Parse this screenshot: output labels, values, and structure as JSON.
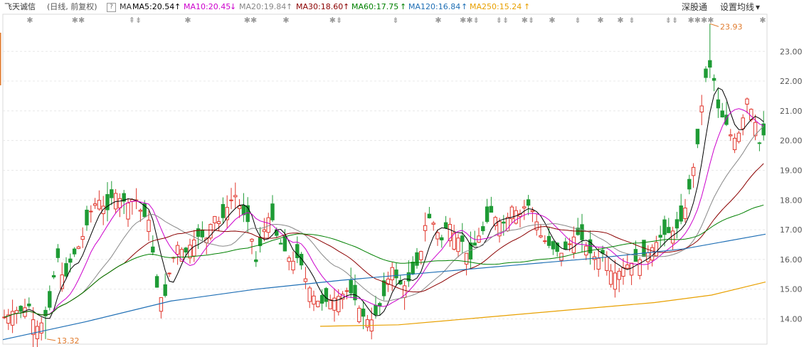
{
  "header": {
    "stock_name": "飞天诚信",
    "mode": "(日线, 前复权)",
    "help_icon": "?",
    "ma_label": "MA",
    "mas": [
      {
        "label": "MA5:20.54",
        "arrow": "↑",
        "color": "#000000"
      },
      {
        "label": "MA10:20.45",
        "arrow": "↓",
        "color": "#cc00cc"
      },
      {
        "label": "MA20:19.84",
        "arrow": "↑",
        "color": "#888888"
      },
      {
        "label": "MA30:18.60",
        "arrow": "↑",
        "color": "#8b0000"
      },
      {
        "label": "MA60:17.75",
        "arrow": "↑",
        "color": "#008000"
      },
      {
        "label": "MA120:16.84",
        "arrow": "↑",
        "color": "#1f6fb5"
      },
      {
        "label": "MA250:15.24",
        "arrow": "↑",
        "color": "#e8a000"
      }
    ],
    "shenhutong": "深股通",
    "settings": "设置均线",
    "dropdown_icon": "▾"
  },
  "chart_data": {
    "type": "candlestick",
    "y_axis": {
      "ticks": [
        "23.00",
        "22.00",
        "21.00",
        "20.00",
        "19.00",
        "18.00",
        "17.00",
        "16.00",
        "15.00",
        "14.00"
      ],
      "ylim": [
        13.15,
        24.25
      ]
    },
    "annotations": {
      "high": "23.93",
      "low": "13.32"
    },
    "event_markers": [
      "✱",
      "✱✱",
      "⇞⇟",
      "✱",
      "✱✱",
      "✱",
      "✱⇟",
      "⇟",
      "✱",
      "✱✱⇟",
      "⇟⇟",
      "✱⇟",
      "✱",
      "⇟",
      "✱",
      "✱",
      "⇟",
      "⇟⇟",
      "✱✱✱✱",
      "✱"
    ]
  }
}
